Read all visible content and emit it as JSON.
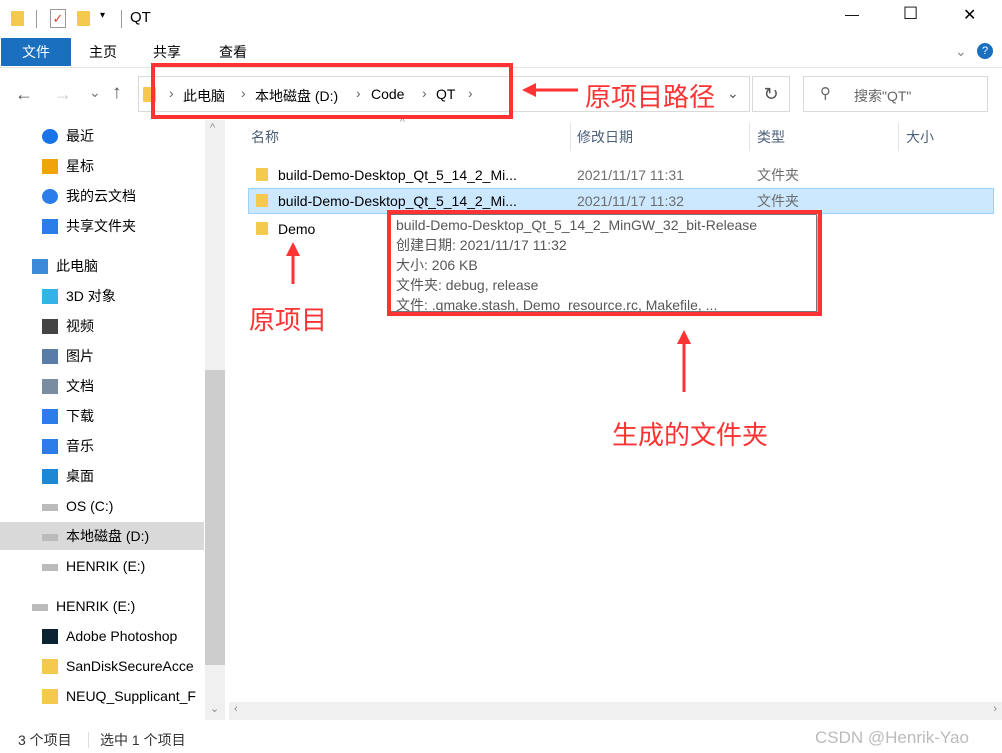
{
  "window": {
    "title": "QT",
    "minimize": "—",
    "maximize": "☐",
    "close": "✕"
  },
  "ribbon": {
    "tabs": [
      "文件",
      "主页",
      "共享",
      "查看"
    ]
  },
  "address": {
    "crumbs": [
      "此电脑",
      "本地磁盘 (D:)",
      "Code",
      "QT"
    ],
    "refresh": "↻"
  },
  "search": {
    "placeholder": "搜索\"QT\""
  },
  "nav": {
    "back": "←",
    "forward": "→",
    "recent": "⌄",
    "up": "↑"
  },
  "sidebar": {
    "items": [
      {
        "label": "最近",
        "icon": "clock-icon",
        "color": "#1a73e8"
      },
      {
        "label": "星标",
        "icon": "star-icon",
        "color": "#f0a30a"
      },
      {
        "label": "我的云文档",
        "icon": "cloud-icon",
        "color": "#2b7de9"
      },
      {
        "label": "共享文件夹",
        "icon": "share-icon",
        "color": "#2b7de9"
      },
      {
        "label": "此电脑",
        "icon": "computer-icon",
        "color": "#3c8ad8",
        "indent": true
      },
      {
        "label": "3D 对象",
        "icon": "cube-icon",
        "color": "#33b3e8"
      },
      {
        "label": "视频",
        "icon": "film-icon",
        "color": "#444"
      },
      {
        "label": "图片",
        "icon": "picture-icon",
        "color": "#5a7da8"
      },
      {
        "label": "文档",
        "icon": "document-icon",
        "color": "#7a8ca0"
      },
      {
        "label": "下载",
        "icon": "download-icon",
        "color": "#2b7de9"
      },
      {
        "label": "音乐",
        "icon": "music-icon",
        "color": "#2b7de9"
      },
      {
        "label": "桌面",
        "icon": "desktop-icon",
        "color": "#1e88d4"
      },
      {
        "label": "OS (C:)",
        "icon": "windows-drive-icon",
        "color": "#888"
      },
      {
        "label": "本地磁盘 (D:)",
        "icon": "drive-icon",
        "color": "#888",
        "selected": true
      },
      {
        "label": "HENRIK (E:)",
        "icon": "drive-icon",
        "color": "#888"
      },
      {
        "label": "HENRIK (E:)",
        "icon": "drive-icon",
        "color": "#888",
        "indent": true
      },
      {
        "label": "Adobe Photoshop",
        "icon": "photoshop-icon",
        "color": "#0b2232"
      },
      {
        "label": "SanDiskSecureAcce",
        "icon": "folder-icon",
        "color": "#f3c94e"
      },
      {
        "label": "NEUQ_Supplicant_F",
        "icon": "zip-folder-icon",
        "color": "#f3c94e"
      }
    ]
  },
  "columns": {
    "name": "名称",
    "modified": "修改日期",
    "type": "类型",
    "size": "大小"
  },
  "files": [
    {
      "name": "build-Demo-Desktop_Qt_5_14_2_Mi...",
      "modified": "2021/11/17 11:31",
      "type": "文件夹"
    },
    {
      "name": "build-Demo-Desktop_Qt_5_14_2_Mi...",
      "modified": "2021/11/17 11:32",
      "type": "文件夹",
      "selected": true
    },
    {
      "name": "Demo",
      "modified": "",
      "type": ""
    }
  ],
  "tooltip": {
    "lines": [
      "build-Demo-Desktop_Qt_5_14_2_MinGW_32_bit-Release",
      "创建日期: 2021/11/17 11:32",
      "大小: 206 KB",
      "文件夹: debug, release",
      "文件: .qmake.stash, Demo_resource.rc, Makefile, ..."
    ]
  },
  "annotations": {
    "path": "原项目路径",
    "original": "原项目",
    "generated": "生成的文件夹",
    "color": "#ff3333"
  },
  "status": {
    "count": "3 个项目",
    "selected": "选中 1 个项目"
  },
  "watermark": "CSDN @Henrik-Yao"
}
